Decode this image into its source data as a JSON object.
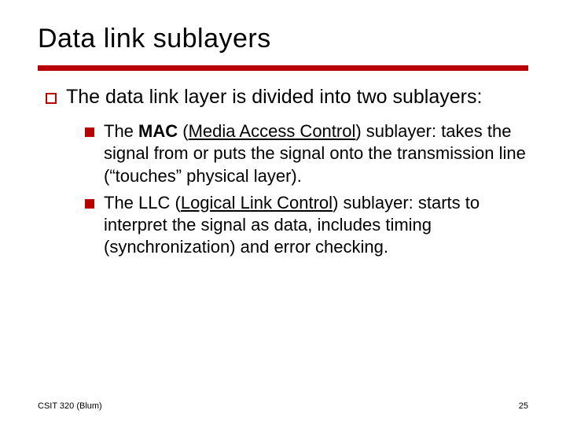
{
  "title": "Data link sublayers",
  "l1": "The data link layer is divided into two sublayers:",
  "mac": {
    "pre": "The ",
    "bold": "MAC",
    "space": " ",
    "paren_open": "(",
    "underline": "Media Access Control",
    "paren_close": ")",
    "rest": " sublayer: takes the signal from or puts the signal onto the transmission line (“touches” physical layer)."
  },
  "llc": {
    "pre": "The LLC ",
    "paren_open": "(",
    "underline": "Logical Link Control",
    "paren_close": ")",
    "rest": " sublayer: starts to interpret the signal as data, includes timing (synchronization) and error checking."
  },
  "footer_left": "CSIT 320 (Blum)",
  "footer_right": "25"
}
